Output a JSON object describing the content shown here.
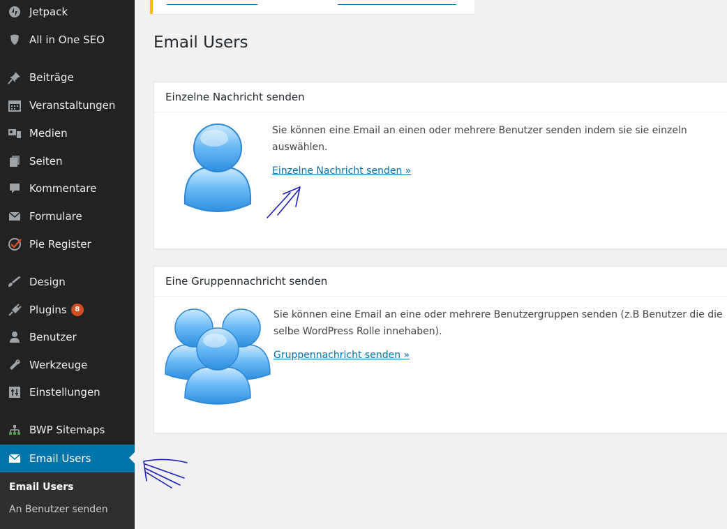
{
  "sidebar": {
    "items": [
      {
        "label": "Jetpack",
        "icon": "jetpack-icon"
      },
      {
        "label": "All in One SEO",
        "icon": "shield-icon"
      },
      {
        "label": "Beiträge",
        "icon": "pin-icon"
      },
      {
        "label": "Veranstaltungen",
        "icon": "calendar-icon"
      },
      {
        "label": "Medien",
        "icon": "media-icon"
      },
      {
        "label": "Seiten",
        "icon": "pages-icon"
      },
      {
        "label": "Kommentare",
        "icon": "comment-icon"
      },
      {
        "label": "Formulare",
        "icon": "mail-icon"
      },
      {
        "label": "Pie Register",
        "icon": "check-circle-icon"
      },
      {
        "label": "Design",
        "icon": "paintbrush-icon"
      },
      {
        "label": "Plugins",
        "icon": "plug-icon",
        "badge": "8"
      },
      {
        "label": "Benutzer",
        "icon": "user-icon"
      },
      {
        "label": "Werkzeuge",
        "icon": "wrench-icon"
      },
      {
        "label": "Einstellungen",
        "icon": "settings-icon"
      },
      {
        "label": "BWP Sitemaps",
        "icon": "sitemap-icon"
      },
      {
        "label": "Email Users",
        "icon": "envelope-icon",
        "active": true
      }
    ],
    "submenu": [
      "Email Users",
      "An Benutzer senden"
    ]
  },
  "colors": {
    "sidebar_bg": "#222222",
    "active_bg": "#0073aa",
    "link": "#0073aa",
    "badge": "#d54e21",
    "notice_border": "#ffb900",
    "ink": "#1d1db8"
  },
  "main": {
    "title": "Email Users",
    "boxes": [
      {
        "heading": "Einzelne Nachricht senden",
        "text": "Sie können eine Email an einen oder mehrere Benutzer senden indem sie sie einzeln auswählen.",
        "link": "Einzelne Nachricht senden »",
        "icon": "single-user-icon"
      },
      {
        "heading": "Eine Gruppennachricht senden",
        "text": "Sie können eine Email an eine oder mehrere Benutzergruppen senden (z.B Benutzer die die selbe WordPress Rolle innehaben).",
        "link": "Gruppennachricht senden »",
        "icon": "user-group-icon"
      }
    ]
  }
}
